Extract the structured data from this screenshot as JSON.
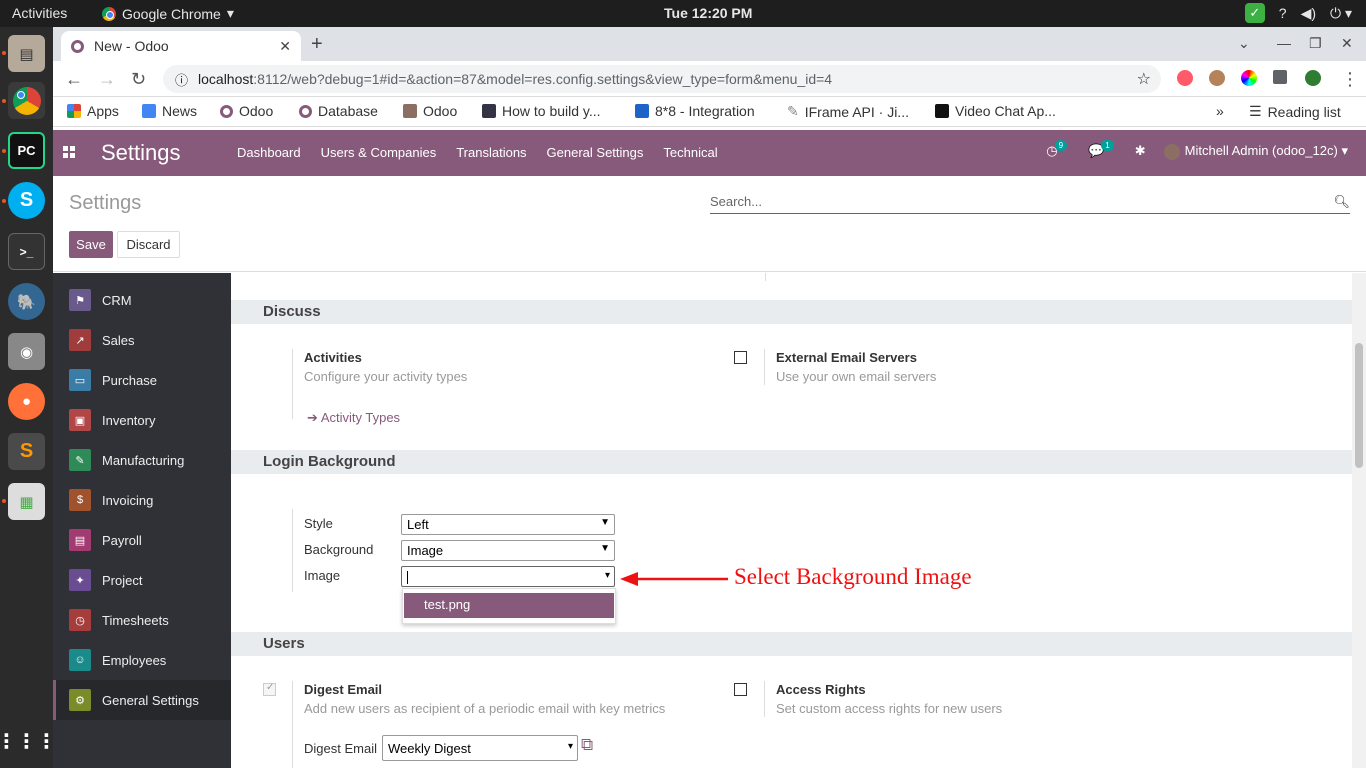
{
  "desktop": {
    "activities": "Activities",
    "app_menu": "Google Chrome",
    "clock": "Tue 12:20 PM"
  },
  "browser": {
    "tab_title": "New - Odoo",
    "url_host": "localhost",
    "url_path": ":8112/web?debug=1#id=&action=87&model=res.config.settings&view_type=form&menu_id=4",
    "bookmarks": [
      {
        "label": "Apps",
        "icon": "apps-grid-icon"
      },
      {
        "label": "News",
        "icon": "news-icon"
      },
      {
        "label": "Odoo",
        "icon": "odoo-icon"
      },
      {
        "label": "Database",
        "icon": "odoo-icon"
      },
      {
        "label": "Odoo",
        "icon": "odoo-square-icon"
      },
      {
        "label": "How to build y...",
        "icon": "tds-icon"
      },
      {
        "label": "8*8 - Integration",
        "icon": "doc-icon"
      },
      {
        "label": "IFrame API · Ji...",
        "icon": "jitsi-icon"
      },
      {
        "label": "Video Chat Ap...",
        "icon": "video-icon"
      }
    ],
    "reading_list": "Reading list"
  },
  "odoo": {
    "brand": "Settings",
    "menu": [
      "Dashboard",
      "Users & Companies",
      "Translations",
      "General Settings",
      "Technical"
    ],
    "activity_count": "9",
    "message_count": "1",
    "user": "Mitchell Admin (odoo_12c)",
    "breadcrumb": "Settings",
    "search_placeholder": "Search...",
    "save_label": "Save",
    "discard_label": "Discard"
  },
  "sidebar": {
    "items": [
      {
        "label": "CRM",
        "color": "#6a5a8c",
        "icon": "crm-handshake-icon"
      },
      {
        "label": "Sales",
        "color": "#a13c3c",
        "icon": "sales-chart-icon"
      },
      {
        "label": "Purchase",
        "color": "#3a7ca5",
        "icon": "purchase-card-icon"
      },
      {
        "label": "Inventory",
        "color": "#b04646",
        "icon": "inventory-box-icon"
      },
      {
        "label": "Manufacturing",
        "color": "#2e8b57",
        "icon": "wrench-icon"
      },
      {
        "label": "Invoicing",
        "color": "#a0522d",
        "icon": "invoice-icon"
      },
      {
        "label": "Payroll",
        "color": "#a23b72",
        "icon": "payroll-icon"
      },
      {
        "label": "Project",
        "color": "#6a4c93",
        "icon": "puzzle-icon"
      },
      {
        "label": "Timesheets",
        "color": "#a63d3d",
        "icon": "stopwatch-icon"
      },
      {
        "label": "Employees",
        "color": "#1a8a8a",
        "icon": "people-icon"
      },
      {
        "label": "General Settings",
        "color": "#7a8b2a",
        "icon": "gear-icon"
      }
    ]
  },
  "discuss": {
    "heading": "Discuss",
    "activities_title": "Activities",
    "activities_desc": "Configure your activity types",
    "activity_types_link": "Activity Types",
    "ext_email_title": "External Email Servers",
    "ext_email_desc": "Use your own email servers"
  },
  "login_background": {
    "heading": "Login Background",
    "style_label": "Style",
    "style_value": "Left",
    "background_label": "Background",
    "background_value": "Image",
    "image_label": "Image",
    "image_value": "",
    "dropdown_option": "test.png"
  },
  "users": {
    "heading": "Users",
    "digest_title": "Digest Email",
    "digest_desc": "Add new users as recipient of a periodic email with key metrics",
    "digest_field_label": "Digest Email",
    "digest_field_value": "Weekly Digest",
    "access_title": "Access Rights",
    "access_desc": "Set custom access rights for new users"
  },
  "annotation": {
    "text": "Select Background Image",
    "color": "#ee1111"
  },
  "colors": {
    "odoo_primary": "#875a7b",
    "sidebar_bg": "#2f3136",
    "section_bg": "#e9ecef"
  }
}
